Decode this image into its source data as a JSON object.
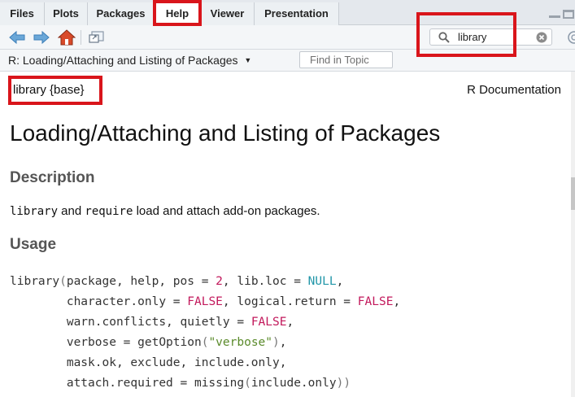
{
  "tabs": [
    {
      "label": "Files"
    },
    {
      "label": "Plots"
    },
    {
      "label": "Packages"
    },
    {
      "label": "Help"
    },
    {
      "label": "Viewer"
    },
    {
      "label": "Presentation"
    }
  ],
  "search": {
    "value": "library"
  },
  "topic": {
    "title": "R: Loading/Attaching and Listing of Packages",
    "find_placeholder": "Find in Topic"
  },
  "doc": {
    "package_line": "library {base}",
    "r_documentation": "R Documentation",
    "title": "Loading/Attaching and Listing of Packages",
    "description_heading": "Description",
    "desc_code1": "library",
    "desc_and": " and ",
    "desc_code2": "require",
    "desc_rest": " load and attach add-on packages.",
    "usage_heading": "Usage"
  },
  "usage": [
    [
      "library",
      "(",
      "package, help, pos = ",
      "2",
      ", lib.loc = ",
      "NULL",
      ","
    ],
    [
      "        character.only = ",
      "FALSE",
      ", logical.return = ",
      "FALSE",
      ","
    ],
    [
      "        warn.conflicts, quietly = ",
      "FALSE",
      ","
    ],
    [
      "        verbose = getOption",
      "(",
      "\"verbose\"",
      ")",
      ","
    ],
    [
      "        mask.ok, exclude, include.only,"
    ],
    [
      "        attach.required = missing",
      "(",
      "include.only",
      "))"
    ]
  ],
  "colors": {
    "highlight": "#d9151b",
    "number": "#c2185b",
    "null": "#2196a8",
    "string": "#5a8a2a"
  }
}
